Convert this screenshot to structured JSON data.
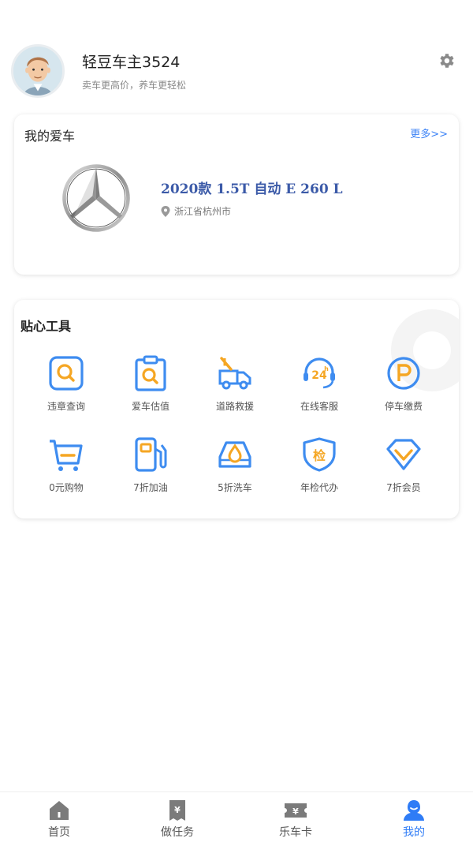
{
  "profile": {
    "username": "轻豆车主3524",
    "slogan": "卖车更高价，养车更轻松"
  },
  "my_car": {
    "title": "我的爱车",
    "more_label": "更多>>",
    "model": "2020款 1.5T 自动 E 260 L",
    "location": "浙江省杭州市"
  },
  "tools": {
    "title": "贴心工具",
    "items": [
      {
        "label": "违章查询",
        "icon": "violation-search-icon"
      },
      {
        "label": "爱车估值",
        "icon": "car-valuation-icon"
      },
      {
        "label": "道路救援",
        "icon": "road-rescue-icon"
      },
      {
        "label": "在线客服",
        "icon": "online-service-icon"
      },
      {
        "label": "停车缴费",
        "icon": "parking-fee-icon"
      },
      {
        "label": "0元购物",
        "icon": "shopping-cart-icon"
      },
      {
        "label": "7折加油",
        "icon": "fuel-icon"
      },
      {
        "label": "5折洗车",
        "icon": "car-wash-icon"
      },
      {
        "label": "年检代办",
        "icon": "inspection-icon"
      },
      {
        "label": "7折会员",
        "icon": "membership-icon"
      }
    ]
  },
  "tabbar": {
    "items": [
      {
        "label": "首页",
        "icon": "home-icon"
      },
      {
        "label": "做任务",
        "icon": "task-icon"
      },
      {
        "label": "乐车卡",
        "icon": "card-icon"
      },
      {
        "label": "我的",
        "icon": "profile-icon",
        "active": true
      }
    ]
  },
  "colors": {
    "accent": "#2f7cf6",
    "icon_blue": "#3e8cf0",
    "icon_orange": "#f5a623",
    "model_text": "#3b5aa8"
  }
}
